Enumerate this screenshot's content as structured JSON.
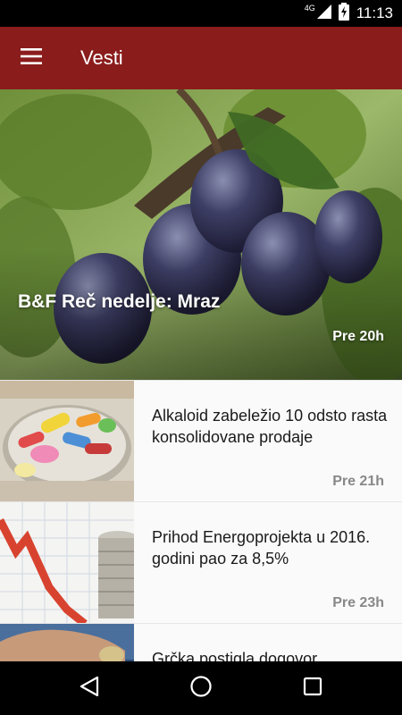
{
  "status_bar": {
    "network": "4G",
    "time": "11:13"
  },
  "app_bar": {
    "title": "Vesti",
    "menu_icon": "hamburger-menu-icon"
  },
  "hero": {
    "title": "B&F Reč nedelje: Mraz",
    "time": "Pre 20h"
  },
  "news": [
    {
      "title": "Alkaloid zabeležio 10 odsto rasta konsolidovane prodaje",
      "time": "Pre 21h",
      "thumb": "pills-image"
    },
    {
      "title": "Prihod Energoprojekta u 2016. godini pao za 8,5%",
      "time": "Pre 23h",
      "thumb": "coins-chart-image"
    },
    {
      "title": "Grčka postigla dogovor",
      "time": "",
      "thumb": "hand-coin-image"
    }
  ],
  "colors": {
    "app_bar": "#8b1c1c",
    "list_bg": "#fafafa",
    "time_text": "#888888"
  },
  "nav_bar": {
    "back_icon": "back-triangle-icon",
    "home_icon": "home-circle-icon",
    "recents_icon": "recents-square-icon"
  }
}
